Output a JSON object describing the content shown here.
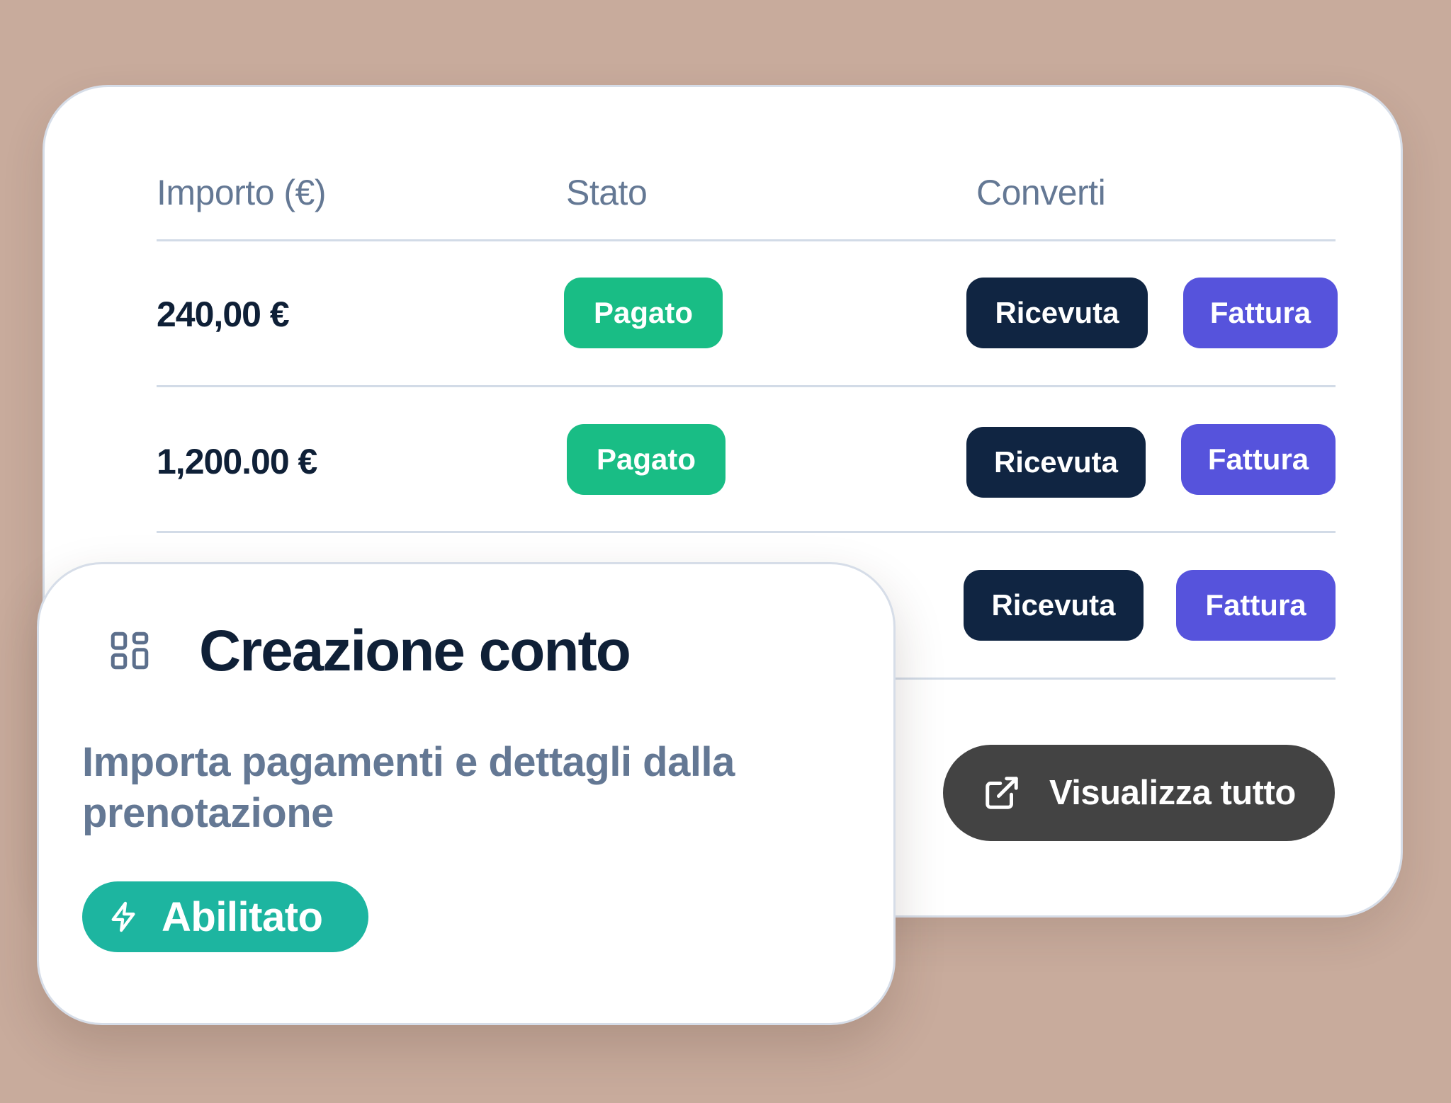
{
  "table": {
    "headers": {
      "amount": "Importo (€)",
      "status": "Stato",
      "convert": "Converti"
    },
    "rows": [
      {
        "amount": "240,00 €",
        "status": "Pagato",
        "receipt_label": "Ricevuta",
        "invoice_label": "Fattura"
      },
      {
        "amount": "1,200.00 €",
        "status": "Pagato",
        "receipt_label": "Ricevuta",
        "invoice_label": "Fattura"
      },
      {
        "amount": "",
        "status": "",
        "receipt_label": "Ricevuta",
        "invoice_label": "Fattura"
      }
    ]
  },
  "view_all": {
    "label": "Visualizza tutto",
    "icon": "external-link-icon"
  },
  "feature_card": {
    "icon": "grid-icon",
    "title": "Creazione conto",
    "description": "Importa pagamenti e dettagli dalla prenotazione",
    "badge": {
      "label": "Abilitato",
      "icon": "lightning-icon"
    }
  },
  "colors": {
    "background": "#c8ab9c",
    "paid": "#19bd85",
    "receipt_button": "#102542",
    "invoice_button": "#5653dc",
    "view_all_button": "#434343",
    "enabled_badge": "#1db5a0",
    "heading_text": "#0f2037",
    "muted_text": "#647894"
  }
}
